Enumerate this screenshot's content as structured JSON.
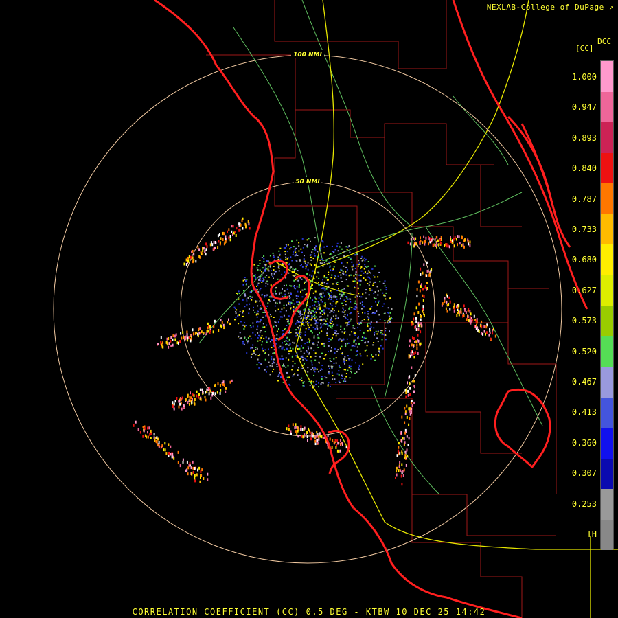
{
  "credit": "NEXLAB-College of DuPage",
  "credit_icon": "cursor-arrow-icon",
  "product_header": "DCC",
  "unit_label": "[CC]",
  "footer": "CORRELATION COEFFICIENT (CC) 0.5 DEG - KTBW 10 DEC 25 14:42",
  "range_rings": [
    {
      "label": "100 NMI"
    },
    {
      "label": "50 NMI"
    }
  ],
  "legend": {
    "ticks": [
      "1.000",
      "0.947",
      "0.893",
      "0.840",
      "0.787",
      "0.733",
      "0.680",
      "0.627",
      "0.573",
      "0.520",
      "0.467",
      "0.413",
      "0.360",
      "0.307",
      "0.253",
      "TH"
    ],
    "colors": [
      "#ff99cc",
      "#ee6699",
      "#cc2255",
      "#ee1111",
      "#ff7700",
      "#ffbb00",
      "#ffee00",
      "#ddee00",
      "#99cc00",
      "#55dd55",
      "#9999dd",
      "#4455dd",
      "#1111ee",
      "#0a0ab0",
      "#999999",
      "#888888"
    ]
  },
  "colors": {
    "coastline": "#ff1f1f",
    "county_lines": "#a01818",
    "highways": "#e6e600",
    "roads": "#60c060",
    "range_ring": "#f0c8a0",
    "text": "#ffff33"
  }
}
